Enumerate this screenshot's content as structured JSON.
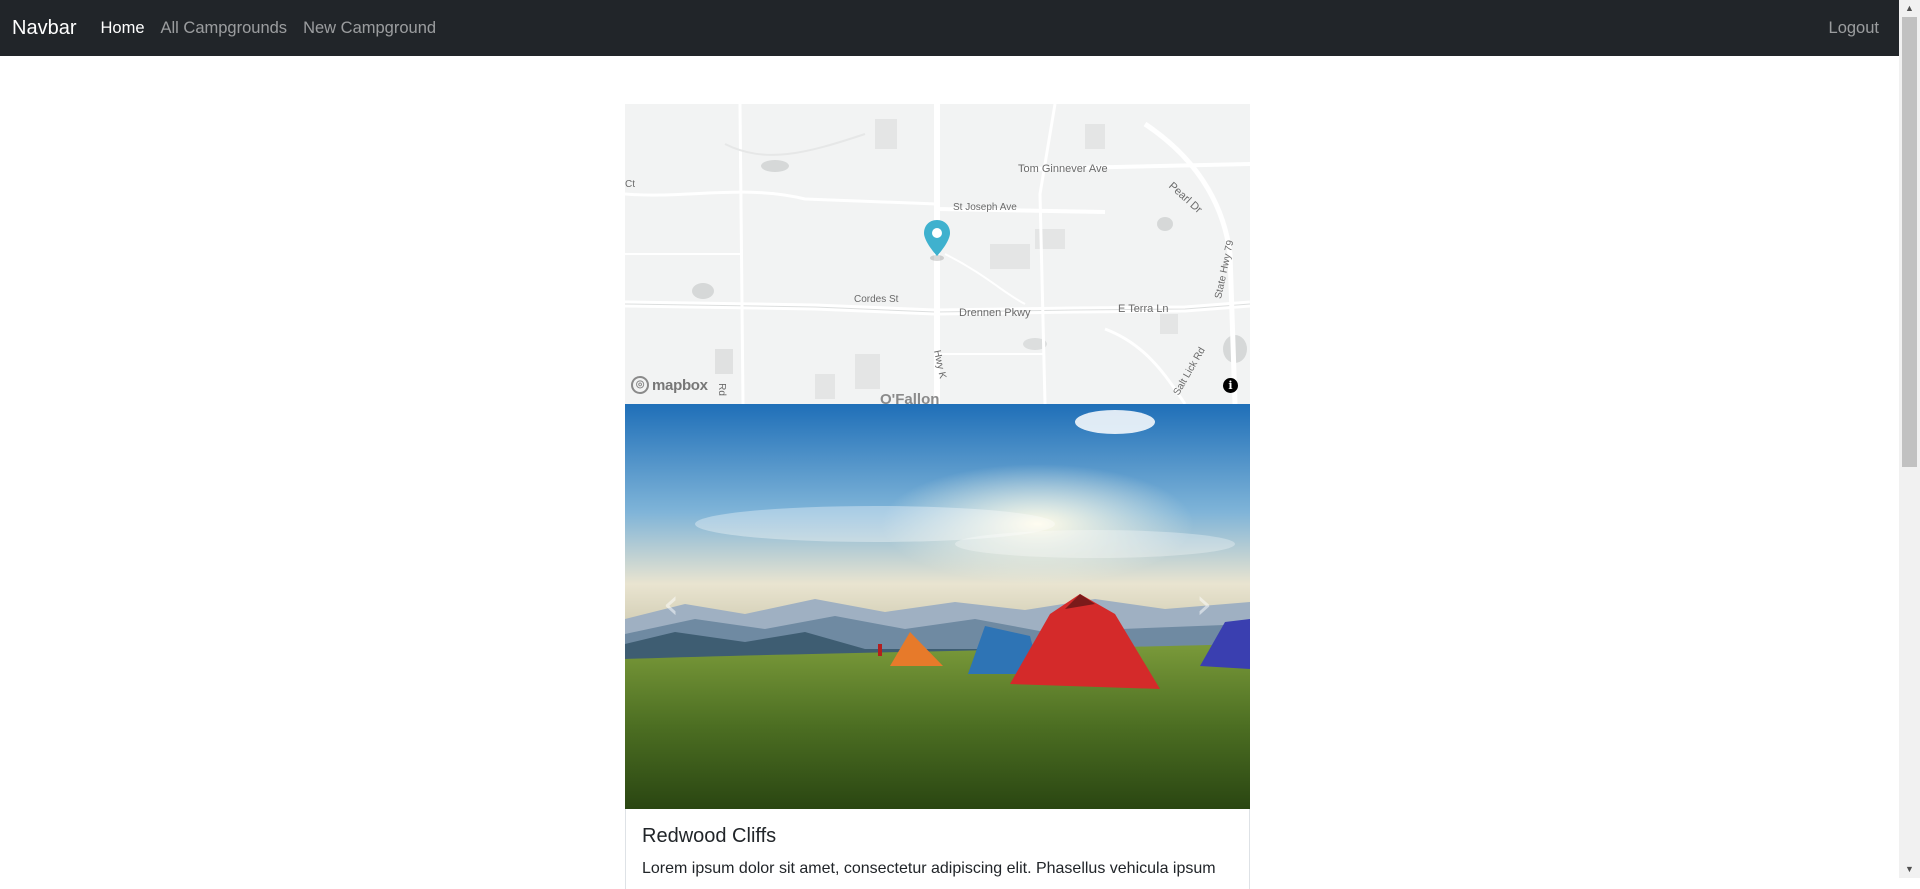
{
  "navbar": {
    "brand": "Navbar",
    "links": [
      {
        "label": "Home"
      },
      {
        "label": "All Campgrounds"
      },
      {
        "label": "New Campground"
      }
    ],
    "logout": "Logout"
  },
  "map": {
    "labels": {
      "tom_ginnever": "Tom Ginnever Ave",
      "pearl": "Pearl Dr",
      "st_joseph": "St Joseph Ave",
      "cordes": "Cordes St",
      "drennen": "Drennen Pkwy",
      "terra": "E Terra Ln",
      "state_hwy": "State Hwy 79",
      "hwy_k": "Hwy K",
      "salt_lick": "Salt Lick Rd",
      "city": "O'Fallon",
      "rd": "Rd",
      "ct": "Ct"
    },
    "attribution": "mapbox",
    "info_icon": "i"
  },
  "carousel": {
    "prev_icon": "‹",
    "next_icon": "›"
  },
  "campground": {
    "title": "Redwood Cliffs",
    "description": "Lorem ipsum dolor sit amet, consectetur adipiscing elit. Phasellus vehicula ipsum"
  }
}
